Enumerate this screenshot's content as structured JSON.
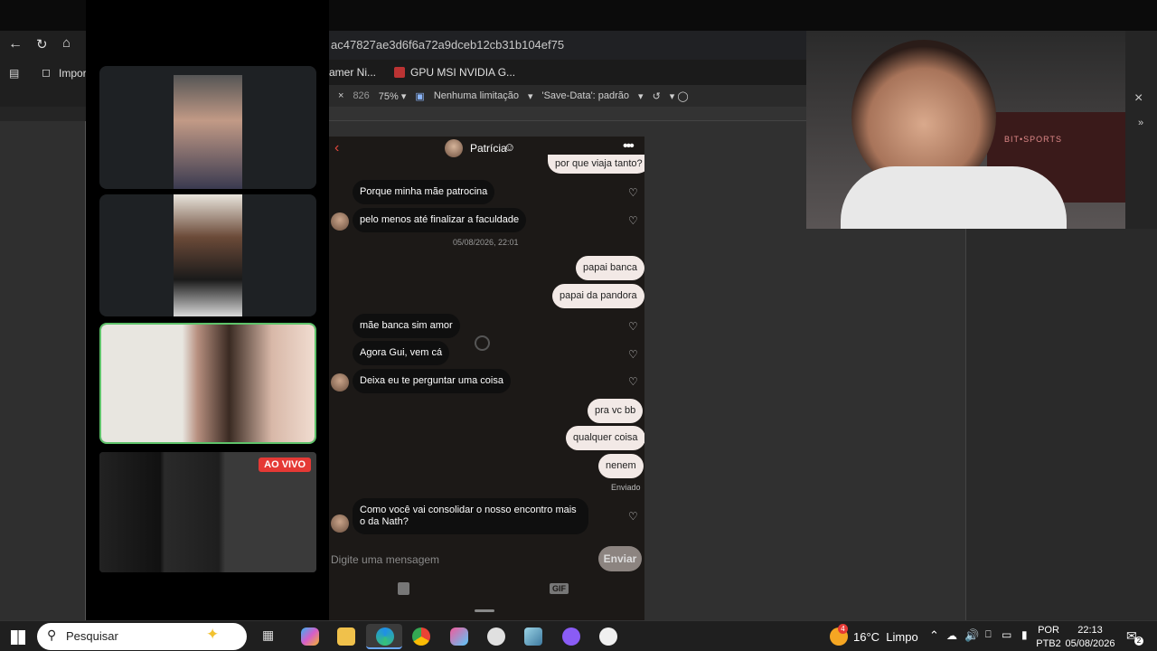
{
  "browser": {
    "url": "ac47827ae3d6f6a72a9dceb12cb31b104ef75",
    "import_label": "Import",
    "bookmarks": [
      "amer Ni...",
      "GPU MSI NVIDIA G..."
    ],
    "devtools": {
      "width": "826",
      "zoom": "75%",
      "throttle": "Nenhuma limitação",
      "save_data": "'Save-Data': padrão"
    }
  },
  "call": {
    "live_badge": "AO VIVO"
  },
  "chat": {
    "contact_name": "Patrícia",
    "messages": [
      {
        "dir": "out",
        "text": "por que viaja tanto?"
      },
      {
        "dir": "in",
        "text": "Porque minha mãe patrocina"
      },
      {
        "dir": "in",
        "text": "pelo menos até finalizar a faculdade"
      },
      {
        "dir": "meta",
        "text": "05/08/2026, 22:01"
      },
      {
        "dir": "out",
        "text": "papai banca"
      },
      {
        "dir": "out",
        "text": "papai  da pandora"
      },
      {
        "dir": "in",
        "text": "mãe banca sim amor"
      },
      {
        "dir": "in",
        "text": "Agora Gui, vem cá"
      },
      {
        "dir": "in",
        "text": "Deixa eu te perguntar uma coisa"
      },
      {
        "dir": "out",
        "text": "pra vc bb"
      },
      {
        "dir": "out",
        "text": "qualquer coisa"
      },
      {
        "dir": "out",
        "text": "nenem"
      },
      {
        "dir": "meta",
        "text": "Enviado"
      },
      {
        "dir": "in",
        "text": "Como você vai consolidar o nosso encontro mais o da Nath?"
      }
    ],
    "input_placeholder": "Digite uma mensagem",
    "send_label": "Enviar",
    "gif_label": "GIF"
  },
  "webcam": {
    "overlay_text": "BIT•SPORTS"
  },
  "taskbar": {
    "search_placeholder": "Pesquisar",
    "weather_badge": "4",
    "weather": "16°C  Limpo",
    "lang_top": "POR",
    "lang_bottom": "PTB2",
    "time": "22:13",
    "date": "05/08/2026",
    "notif_count": "2"
  },
  "colors": {
    "chat_bg": "#1c1917",
    "bubble_out": "#f2e9e6",
    "bubble_in": "#0f0f0f",
    "active_tile_border": "#5ec26a",
    "live_badge": "#e53935"
  }
}
